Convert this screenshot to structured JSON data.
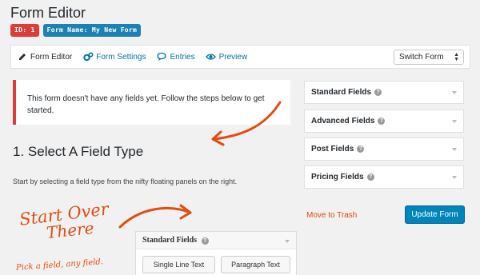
{
  "header": {
    "title": "Form Editor",
    "id_badge": "ID: 1",
    "name_badge": "Form Name: My New Form"
  },
  "toolbar": {
    "items": [
      {
        "label": "Form Editor",
        "icon": "pencil-icon"
      },
      {
        "label": "Form Settings",
        "icon": "gears-icon"
      },
      {
        "label": "Entries",
        "icon": "comment-icon"
      },
      {
        "label": "Preview",
        "icon": "eye-icon"
      }
    ],
    "switch_form": "Switch Form"
  },
  "notice": {
    "text": "This form doesn't have any fields yet. Follow the steps below to get started."
  },
  "main": {
    "heading": "1. Select A Field Type",
    "description": "Start by selecting a field type from the nifty floating panels on the right."
  },
  "panels": [
    {
      "label": "Standard Fields"
    },
    {
      "label": "Advanced Fields"
    },
    {
      "label": "Post Fields"
    },
    {
      "label": "Pricing Fields"
    }
  ],
  "actions": {
    "trash": "Move to Trash",
    "update": "Update Form"
  },
  "annotation": {
    "start_line1": "Start Over",
    "start_line2": "There",
    "pick": "Pick a field, any field.",
    "panel_title": "Standard Fields",
    "buttons": [
      "Single Line Text",
      "Paragraph Text"
    ]
  },
  "colors": {
    "accent": "#0085ba",
    "error": "#dd3d36",
    "handwriting": "#e14d12"
  }
}
